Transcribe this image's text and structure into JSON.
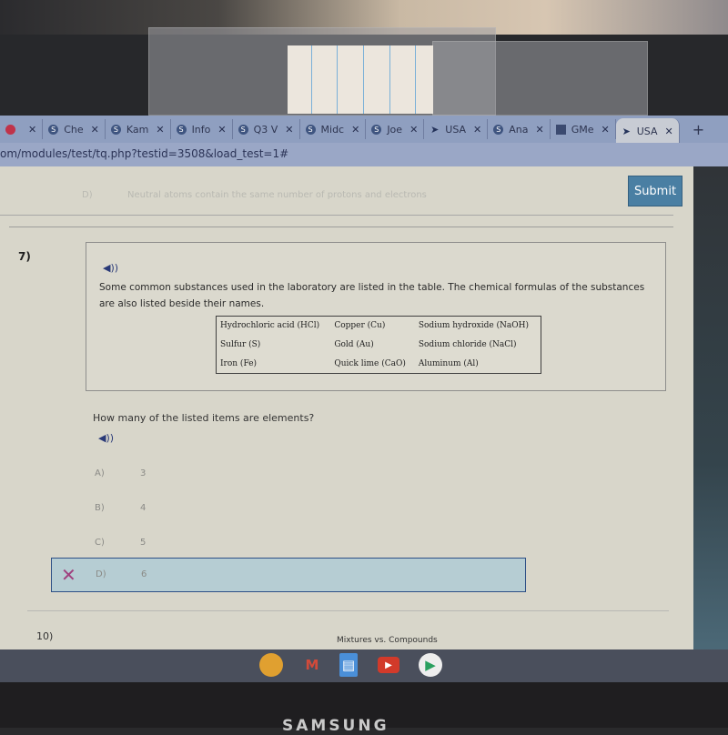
{
  "browser": {
    "tabs": [
      {
        "label": "",
        "icon": "red-dot-icon",
        "active": false
      },
      {
        "label": "Che",
        "icon": "s-app-icon",
        "active": false
      },
      {
        "label": "Kam",
        "icon": "s-app-icon",
        "active": false
      },
      {
        "label": "Info",
        "icon": "s-app-icon",
        "active": false
      },
      {
        "label": "Q3 V",
        "icon": "s-app-icon",
        "active": false
      },
      {
        "label": "Midc",
        "icon": "s-app-icon",
        "active": false
      },
      {
        "label": "Joe",
        "icon": "s-app-icon",
        "active": false
      },
      {
        "label": "USA",
        "icon": "cursor-icon",
        "active": false
      },
      {
        "label": "Ana",
        "icon": "s-app-icon",
        "active": false
      },
      {
        "label": "GMe",
        "icon": "gmetrix-icon",
        "active": false
      },
      {
        "label": "USA",
        "icon": "cursor-icon",
        "active": true
      }
    ],
    "close_glyph": "✕",
    "new_tab_glyph": "+",
    "url": "om/modules/test/tq.php?testid=3508&load_test=1#"
  },
  "previous_question": {
    "option_letter": "D)",
    "option_text": "Neutral atoms contain the same number of protons and electrons"
  },
  "submit_label": "Submit",
  "question": {
    "number": "7)",
    "speaker_glyph": "◀))",
    "stem": "Some common substances used in the laboratory are listed in the table. The chemical formulas of the substances are also listed beside their names.",
    "table": [
      [
        "Hydrochloric acid (HCl)",
        "Copper (Cu)",
        "Sodium hydroxide (NaOH)"
      ],
      [
        "Sulfur (S)",
        "Gold (Au)",
        "Sodium chloride (NaCl)"
      ],
      [
        "Iron (Fe)",
        "Quick lime (CaO)",
        "Aluminum (Al)"
      ]
    ],
    "prompt": "How many of the listed items are elements?",
    "options": [
      {
        "letter": "A)",
        "value": "3",
        "selected": false
      },
      {
        "letter": "B)",
        "value": "4",
        "selected": false
      },
      {
        "letter": "C)",
        "value": "5",
        "selected": false
      },
      {
        "letter": "D)",
        "value": "6",
        "selected": true,
        "marked_incorrect": true
      }
    ],
    "incorrect_glyph": "✕"
  },
  "next_question": {
    "number": "10)",
    "tooltip": "Mixtures vs. Compounds"
  },
  "shelf": {
    "apps": [
      {
        "name": "chrome",
        "glyph": "◉",
        "color": "#e0a030"
      },
      {
        "name": "gmail",
        "glyph": "M",
        "color": "#d24a3a"
      },
      {
        "name": "docs",
        "glyph": "▤",
        "color": "#4a8fd8"
      },
      {
        "name": "youtube",
        "glyph": "▶",
        "color": "#d23a2a"
      },
      {
        "name": "play-store",
        "glyph": "▶",
        "color": "#2aa060"
      }
    ]
  },
  "device": {
    "brand": "SAMSUNG"
  }
}
